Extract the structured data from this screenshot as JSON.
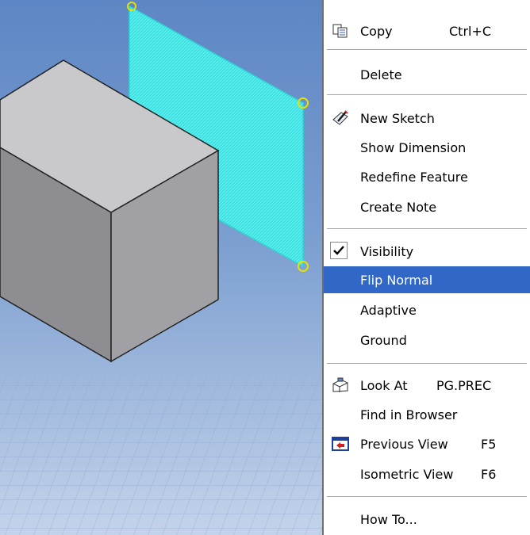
{
  "menu": {
    "items": [
      {
        "label": "Copy",
        "shortcut": "Ctrl+C",
        "icon": "copy-icon"
      },
      {
        "label": "Delete"
      },
      {
        "label": "New Sketch",
        "icon": "new-sketch-icon"
      },
      {
        "label": "Show Dimension"
      },
      {
        "label": "Redefine Feature"
      },
      {
        "label": "Create Note"
      },
      {
        "label": "Visibility",
        "checked": true
      },
      {
        "label": "Flip Normal",
        "highlighted": true
      },
      {
        "label": "Adaptive"
      },
      {
        "label": "Ground"
      },
      {
        "label": "Look At",
        "shortcut": "PG.PREC",
        "icon": "look-at-icon"
      },
      {
        "label": "Find in Browser"
      },
      {
        "label": "Previous View",
        "shortcut": "F5",
        "icon": "previous-view-icon"
      },
      {
        "label": "Isometric View",
        "shortcut": "F6"
      },
      {
        "label": "How To..."
      }
    ]
  },
  "colors": {
    "menu_highlight": "#3167c6",
    "viewport_background": "#7c9fd0",
    "work_plane": "#3fe0e0",
    "plane_handles": "#e8e000",
    "box_top": "#c9c9cb",
    "box_front": "#8e8e92",
    "box_side": "#a1a1a5"
  }
}
